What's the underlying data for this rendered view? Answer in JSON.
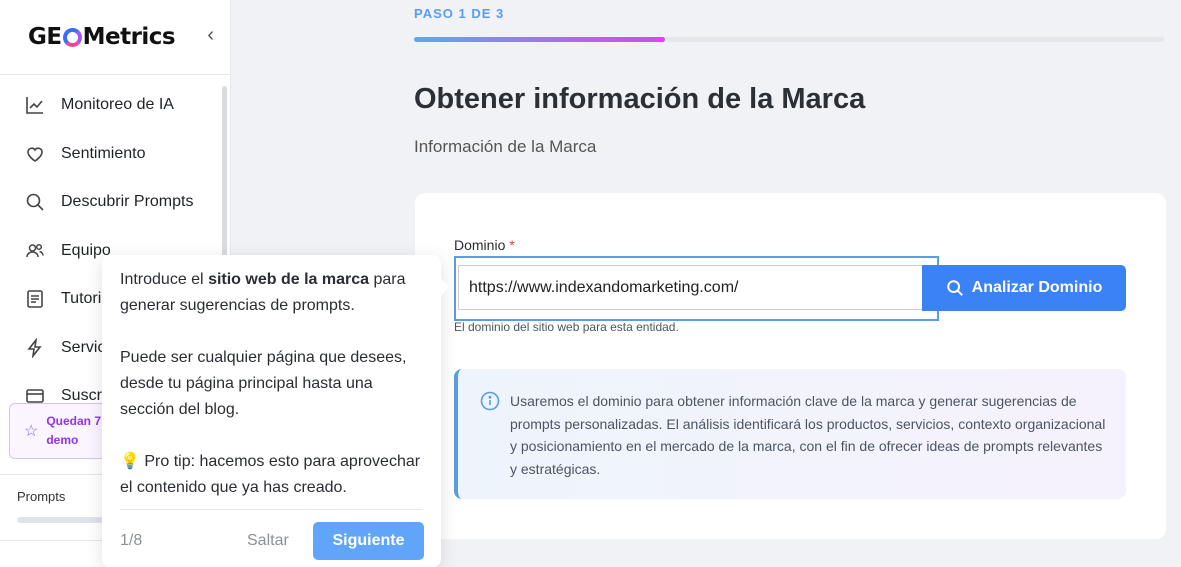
{
  "app": {
    "logo_left": "GE",
    "logo_right": "Metrics",
    "collapse_icon": "chevron-left-icon"
  },
  "sidebar": {
    "items": [
      {
        "label": "Monitoreo de IA",
        "icon": "trending-chart-icon"
      },
      {
        "label": "Sentimiento",
        "icon": "heart-icon"
      },
      {
        "label": "Descubrir Prompts",
        "icon": "search-icon"
      },
      {
        "label": "Equipo",
        "icon": "users-icon"
      },
      {
        "label": "Tutori",
        "icon": "document-icon"
      },
      {
        "label": "Servic",
        "icon": "bolt-icon"
      },
      {
        "label": "Suscr",
        "icon": "card-icon"
      }
    ],
    "demo_line1": "Quedan 7",
    "demo_line2": "demo",
    "prompts_label": "Prompts"
  },
  "main": {
    "step_label": "PASO 1 DE 3",
    "step_progress": 0.334,
    "title": "Obtener información de la Marca",
    "subtitle": "Información de la Marca",
    "field_label": "Dominio",
    "required_mark": "*",
    "domain_value": "https://www.indexandomarketing.com/",
    "analyze_label": "Analizar Dominio",
    "helper_text": "El dominio del sitio web para esta entidad.",
    "info_text": "Usaremos el dominio para obtener información clave de la marca y generar sugerencias de prompts personalizadas. El análisis identificará los productos, servicios, contexto organizacional y posicionamiento en el mercado de la marca, con el fin de ofrecer ideas de prompts relevantes y estratégicas."
  },
  "tooltip": {
    "p1_pre": "Introduce el ",
    "p1_bold": "sitio web de la marca",
    "p1_post": " para generar sugerencias de prompts.",
    "p2": "Puede ser cualquier página que desees, desde tu página principal hasta una sección del blog.",
    "p3_icon": "💡",
    "p3": " Pro tip: hacemos esto para aprovechar el contenido que ya has creado.",
    "counter": "1/8",
    "skip": "Saltar",
    "next": "Siguiente"
  },
  "colors": {
    "accent": "#3b82f6",
    "progress_start": "#60a5fa",
    "progress_end": "#d946ef",
    "demo_purple": "#9333ea"
  }
}
